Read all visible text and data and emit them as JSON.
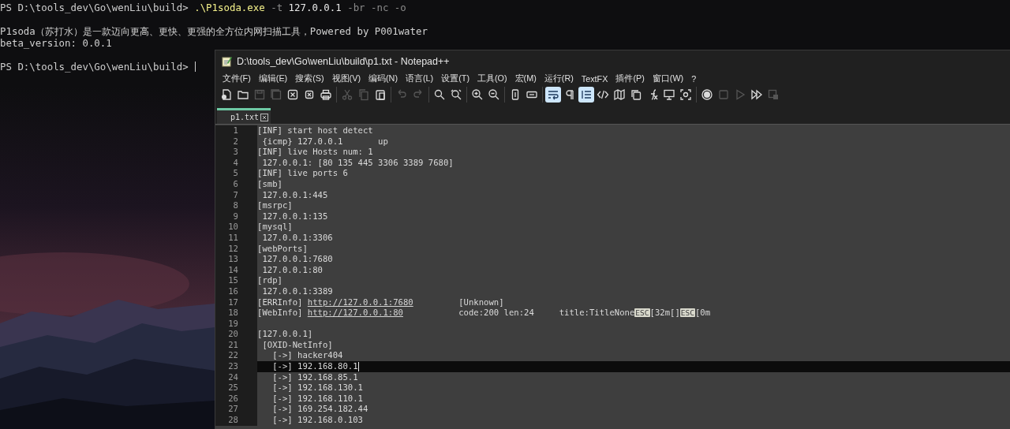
{
  "terminal": {
    "blocks": [
      [
        {
          "segments": [
            {
              "kind": "prompt",
              "text": "PS D:\\tools_dev\\Go\\wenLiu\\build> "
            },
            {
              "kind": "command",
              "text": ".\\P1soda.exe"
            },
            {
              "kind": "flag",
              "text": " -t"
            },
            {
              "kind": "value",
              "text": " 127.0.0.1"
            },
            {
              "kind": "flag",
              "text": " -br -nc -o"
            }
          ],
          "cursor": false
        }
      ],
      [
        {
          "segments": [
            {
              "kind": "output",
              "text": "P1soda（苏打水）是一款迈向更高、更快、更强的全方位内网扫描工具，Powered by P001water"
            }
          ],
          "cursor": false
        },
        {
          "segments": [
            {
              "kind": "output",
              "text": "beta_version: 0.0.1"
            }
          ],
          "cursor": false
        }
      ],
      [
        {
          "segments": [
            {
              "kind": "prompt",
              "text": "PS D:\\tools_dev\\Go\\wenLiu\\build> "
            }
          ],
          "cursor": true
        }
      ]
    ]
  },
  "notepad": {
    "title": "D:\\tools_dev\\Go\\wenLiu\\build\\p1.txt - Notepad++",
    "menu": [
      "文件(F)",
      "编辑(E)",
      "搜索(S)",
      "视图(V)",
      "编码(N)",
      "语言(L)",
      "设置(T)",
      "工具(O)",
      "宏(M)",
      "运行(R)",
      "TextFX",
      "插件(P)",
      "窗口(W)",
      "?"
    ],
    "toolbar": [
      [
        {
          "disabled": false,
          "on": false
        },
        {
          "disabled": false,
          "on": false
        },
        {
          "disabled": true,
          "on": false
        },
        {
          "disabled": true,
          "on": false
        },
        {
          "disabled": false,
          "on": false
        },
        {
          "disabled": false,
          "on": false
        },
        {
          "disabled": false,
          "on": false
        }
      ],
      [
        {
          "disabled": true,
          "on": false
        },
        {
          "disabled": true,
          "on": false
        },
        {
          "disabled": false,
          "on": false
        }
      ],
      [
        {
          "disabled": true,
          "on": false
        },
        {
          "disabled": true,
          "on": false
        }
      ],
      [
        {
          "disabled": false,
          "on": false
        },
        {
          "disabled": false,
          "on": false
        }
      ],
      [
        {
          "disabled": false,
          "on": false
        },
        {
          "disabled": false,
          "on": false
        }
      ],
      [
        {
          "disabled": false,
          "on": false
        },
        {
          "disabled": false,
          "on": false
        }
      ],
      [
        {
          "disabled": false,
          "on": true
        },
        {
          "disabled": false,
          "on": false
        },
        {
          "disabled": false,
          "on": true
        },
        {
          "disabled": false,
          "on": false
        },
        {
          "disabled": false,
          "on": false
        },
        {
          "disabled": false,
          "on": false
        },
        {
          "disabled": false,
          "on": false
        },
        {
          "disabled": false,
          "on": false
        },
        {
          "disabled": false,
          "on": false
        }
      ],
      [
        {
          "disabled": false,
          "on": false
        },
        {
          "disabled": true,
          "on": false
        },
        {
          "disabled": true,
          "on": false
        },
        {
          "disabled": false,
          "on": false
        },
        {
          "disabled": true,
          "on": false
        }
      ]
    ],
    "tabs": [
      {
        "label": "p1.txt",
        "selected": true
      }
    ],
    "lines": [
      {
        "number": "1",
        "current": false,
        "segments": [
          {
            "kind": "text",
            "text": "[INF] start host detect"
          }
        ]
      },
      {
        "number": "2",
        "current": false,
        "segments": [
          {
            "kind": "text",
            "text": " {icmp} 127.0.0.1\t\tup"
          }
        ]
      },
      {
        "number": "3",
        "current": false,
        "segments": [
          {
            "kind": "text",
            "text": "[INF] live Hosts num: 1"
          }
        ]
      },
      {
        "number": "4",
        "current": false,
        "segments": [
          {
            "kind": "text",
            "text": " 127.0.0.1: [80 135 445 3306 3389 7680]"
          }
        ]
      },
      {
        "number": "5",
        "current": false,
        "segments": [
          {
            "kind": "text",
            "text": "[INF] live ports 6"
          }
        ]
      },
      {
        "number": "6",
        "current": false,
        "segments": [
          {
            "kind": "text",
            "text": "[smb]"
          }
        ]
      },
      {
        "number": "7",
        "current": false,
        "segments": [
          {
            "kind": "text",
            "text": " 127.0.0.1:445"
          }
        ]
      },
      {
        "number": "8",
        "current": false,
        "segments": [
          {
            "kind": "text",
            "text": "[msrpc]"
          }
        ]
      },
      {
        "number": "9",
        "current": false,
        "segments": [
          {
            "kind": "text",
            "text": " 127.0.0.1:135"
          }
        ]
      },
      {
        "number": "10",
        "current": false,
        "segments": [
          {
            "kind": "text",
            "text": "[mysql]"
          }
        ]
      },
      {
        "number": "11",
        "current": false,
        "segments": [
          {
            "kind": "text",
            "text": " 127.0.0.1:3306"
          }
        ]
      },
      {
        "number": "12",
        "current": false,
        "segments": [
          {
            "kind": "text",
            "text": "[webPorts]"
          }
        ]
      },
      {
        "number": "13",
        "current": false,
        "segments": [
          {
            "kind": "text",
            "text": " 127.0.0.1:7680"
          }
        ]
      },
      {
        "number": "14",
        "current": false,
        "segments": [
          {
            "kind": "text",
            "text": " 127.0.0.1:80"
          }
        ]
      },
      {
        "number": "15",
        "current": false,
        "segments": [
          {
            "kind": "text",
            "text": "[rdp]"
          }
        ]
      },
      {
        "number": "16",
        "current": false,
        "segments": [
          {
            "kind": "text",
            "text": " 127.0.0.1:3389"
          }
        ]
      },
      {
        "number": "17",
        "current": false,
        "segments": [
          {
            "kind": "text",
            "text": "[ERRInfo] "
          },
          {
            "kind": "link",
            "text": "http://127.0.0.1:7680"
          },
          {
            "kind": "text",
            "text": "\t\t\t[Unknown]"
          }
        ]
      },
      {
        "number": "18",
        "current": false,
        "segments": [
          {
            "kind": "text",
            "text": "[WebInfo] "
          },
          {
            "kind": "link",
            "text": "http://127.0.0.1:80"
          },
          {
            "kind": "text",
            "text": "\t\t\tcode:200 len:24\t\ttitle:TitleNone"
          },
          {
            "kind": "ctrl",
            "text": "ESC"
          },
          {
            "kind": "text",
            "text": "[32m[]"
          },
          {
            "kind": "ctrl",
            "text": "ESC"
          },
          {
            "kind": "text",
            "text": "[0m"
          }
        ]
      },
      {
        "number": "19",
        "current": false
      },
      {
        "number": "20",
        "current": false,
        "segments": [
          {
            "kind": "text",
            "text": "[127.0.0.1]"
          }
        ]
      },
      {
        "number": "21",
        "current": false,
        "segments": [
          {
            "kind": "text",
            "text": " [OXID-NetInfo]"
          }
        ]
      },
      {
        "number": "22",
        "current": false,
        "segments": [
          {
            "kind": "text",
            "text": "   [->] hacker404"
          }
        ]
      },
      {
        "number": "23",
        "current": true,
        "segments": [
          {
            "kind": "text",
            "text": "   [->] 192.168.80.1"
          }
        ]
      },
      {
        "number": "24",
        "current": false,
        "segments": [
          {
            "kind": "text",
            "text": "   [->] 192.168.85.1"
          }
        ]
      },
      {
        "number": "25",
        "current": false,
        "segments": [
          {
            "kind": "text",
            "text": "   [->] 192.168.130.1"
          }
        ]
      },
      {
        "number": "26",
        "current": false,
        "segments": [
          {
            "kind": "text",
            "text": "   [->] 192.168.110.1"
          }
        ]
      },
      {
        "number": "27",
        "current": false,
        "segments": [
          {
            "kind": "text",
            "text": "   [->] 169.254.182.44"
          }
        ]
      },
      {
        "number": "28",
        "current": false,
        "segments": [
          {
            "kind": "text",
            "text": "   [->] 192.168.0.103"
          }
        ]
      }
    ]
  }
}
